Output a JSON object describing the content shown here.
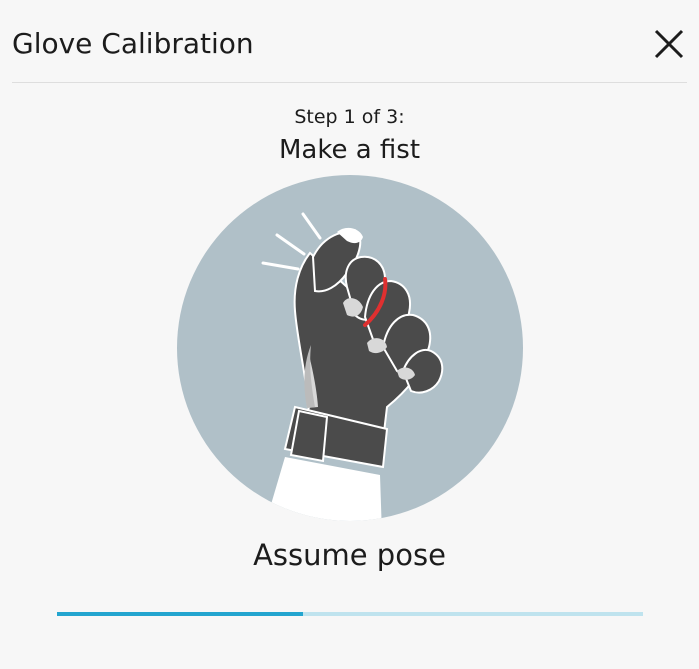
{
  "dialog": {
    "title": "Glove Calibration",
    "close_icon": "close-icon"
  },
  "step": {
    "label": "Step 1 of 3:",
    "instruction": "Make a fist"
  },
  "illustration": {
    "icon": "fist-glove-icon",
    "circle_color": "#b0c0c8",
    "glove_color": "#4b4b4b",
    "highlight_color": "#e03030"
  },
  "status": {
    "text": "Assume pose"
  },
  "progress": {
    "fraction": 0.42,
    "track_color": "#bfe3ee",
    "fill_color": "#23a5cf"
  }
}
